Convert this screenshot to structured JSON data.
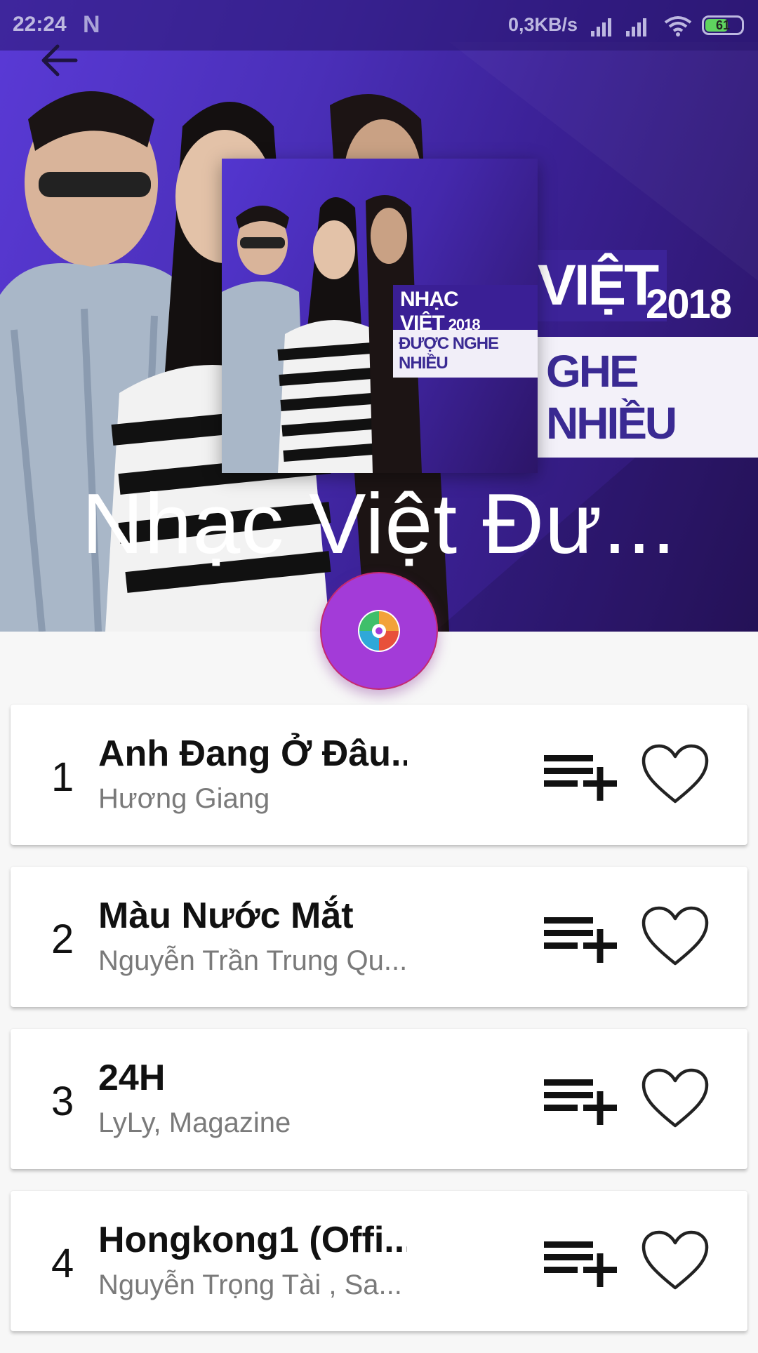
{
  "status_bar": {
    "time": "22:24",
    "app_icon": "N",
    "network_speed": "0,3KB/s",
    "battery": "61"
  },
  "header": {
    "back_icon": "arrow-left-icon",
    "cover_art": {
      "title_line": "NHẠC VIỆT",
      "year": "2018",
      "subtitle_line": "ĐƯỢC NGHE NHIỀU"
    },
    "backdrop_text": {
      "title_fragment": "VIỆT",
      "year": "2018",
      "subtitle_fragment": "GHE NHIỀU"
    },
    "title": "Nhạc Việt Đư...",
    "fab_icon": "disc-icon"
  },
  "songs": [
    {
      "number": "1",
      "title": "Anh Đang Ở Đâu...",
      "artist": "Hương Giang"
    },
    {
      "number": "2",
      "title": "Màu Nước Mắt",
      "artist": "Nguyễn Trần Trung Qu..."
    },
    {
      "number": "3",
      "title": "24H",
      "artist": "LyLy, Magazine"
    },
    {
      "number": "4",
      "title": "Hongkong1 (Offi...",
      "artist": "Nguyễn Trọng Tài , Sa..."
    }
  ],
  "colors": {
    "hero_start": "#5a3ad6",
    "hero_end": "#2a1463",
    "fab": "#a33bd8",
    "artist_text": "#7a7a7a"
  }
}
